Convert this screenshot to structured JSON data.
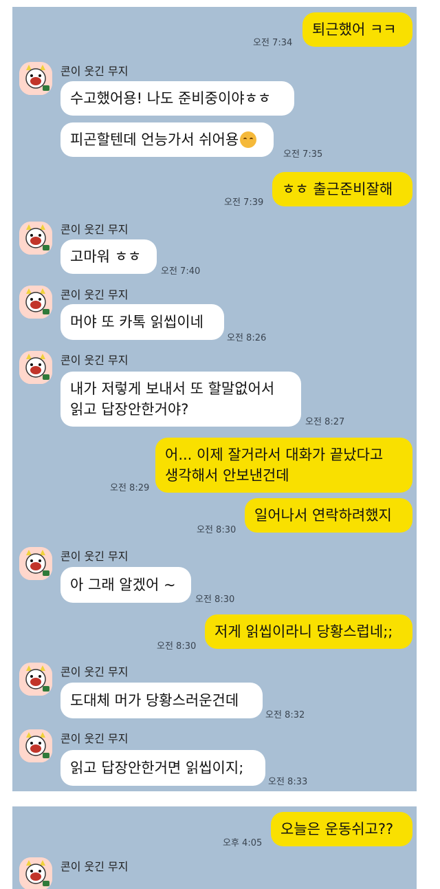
{
  "contact": {
    "name": "콘이 웃긴 무지"
  },
  "messages": [
    {
      "side": "out",
      "text": "퇴근했어 ㅋㅋ",
      "time": "오전 7:34"
    },
    {
      "side": "in",
      "text": "수고했어용! 나도 준비중이야ㅎㅎ",
      "time": ""
    },
    {
      "side": "in",
      "text": "피곤할텐데 언능가서 쉬어용",
      "time": "오전 7:35",
      "emoji": "smiling-face-emoji"
    },
    {
      "side": "out",
      "text": "ㅎㅎ 출근준비잘해",
      "time": "오전 7:39"
    },
    {
      "side": "in",
      "text": "고마워 ㅎㅎ",
      "time": "오전 7:40"
    },
    {
      "side": "in",
      "text": "머야 또 카톡 읽씹이네",
      "time": "오전 8:26"
    },
    {
      "side": "in",
      "text": "내가 저렇게 보내서 또 할말없어서\n읽고 답장안한거야?",
      "time": "오전 8:27"
    },
    {
      "side": "out",
      "text": "어... 이제 잘거라서 대화가 끝났다고\n생각해서 안보낸건데",
      "time": "오전 8:29"
    },
    {
      "side": "out",
      "text": "일어나서 연락하려했지",
      "time": "오전 8:30"
    },
    {
      "side": "in",
      "text": "아 그래 알겠어 ~",
      "time": "오전 8:30"
    },
    {
      "side": "out",
      "text": "저게 읽씹이라니 당황스럽네;;",
      "time": "오전 8:30"
    },
    {
      "side": "in",
      "text": "도대체 머가 당황스러운건데",
      "time": "오전 8:32"
    },
    {
      "side": "in",
      "text": "읽고 답장안한거면 읽씹이지;",
      "time": "오전 8:33"
    },
    {
      "side": "out",
      "text": "오늘은 운동쉬고??",
      "time": "오후 4:05"
    }
  ],
  "colors": {
    "background": "#a9bfd4",
    "outgoing_bubble": "#f9e000",
    "incoming_bubble": "#ffffff"
  },
  "icons": {
    "avatar": "muzi-avatar-icon"
  }
}
